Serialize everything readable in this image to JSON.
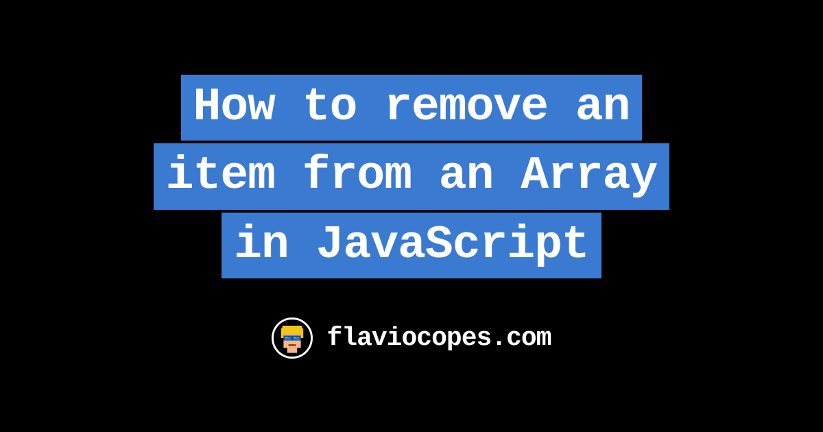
{
  "title": {
    "line1": "How to remove an",
    "line2": "item from an Array",
    "line3": "in JavaScript"
  },
  "footer": {
    "site_name": "flaviocopes.com"
  },
  "colors": {
    "background": "#000000",
    "highlight": "#3b7ad1",
    "text": "#ffffff"
  }
}
